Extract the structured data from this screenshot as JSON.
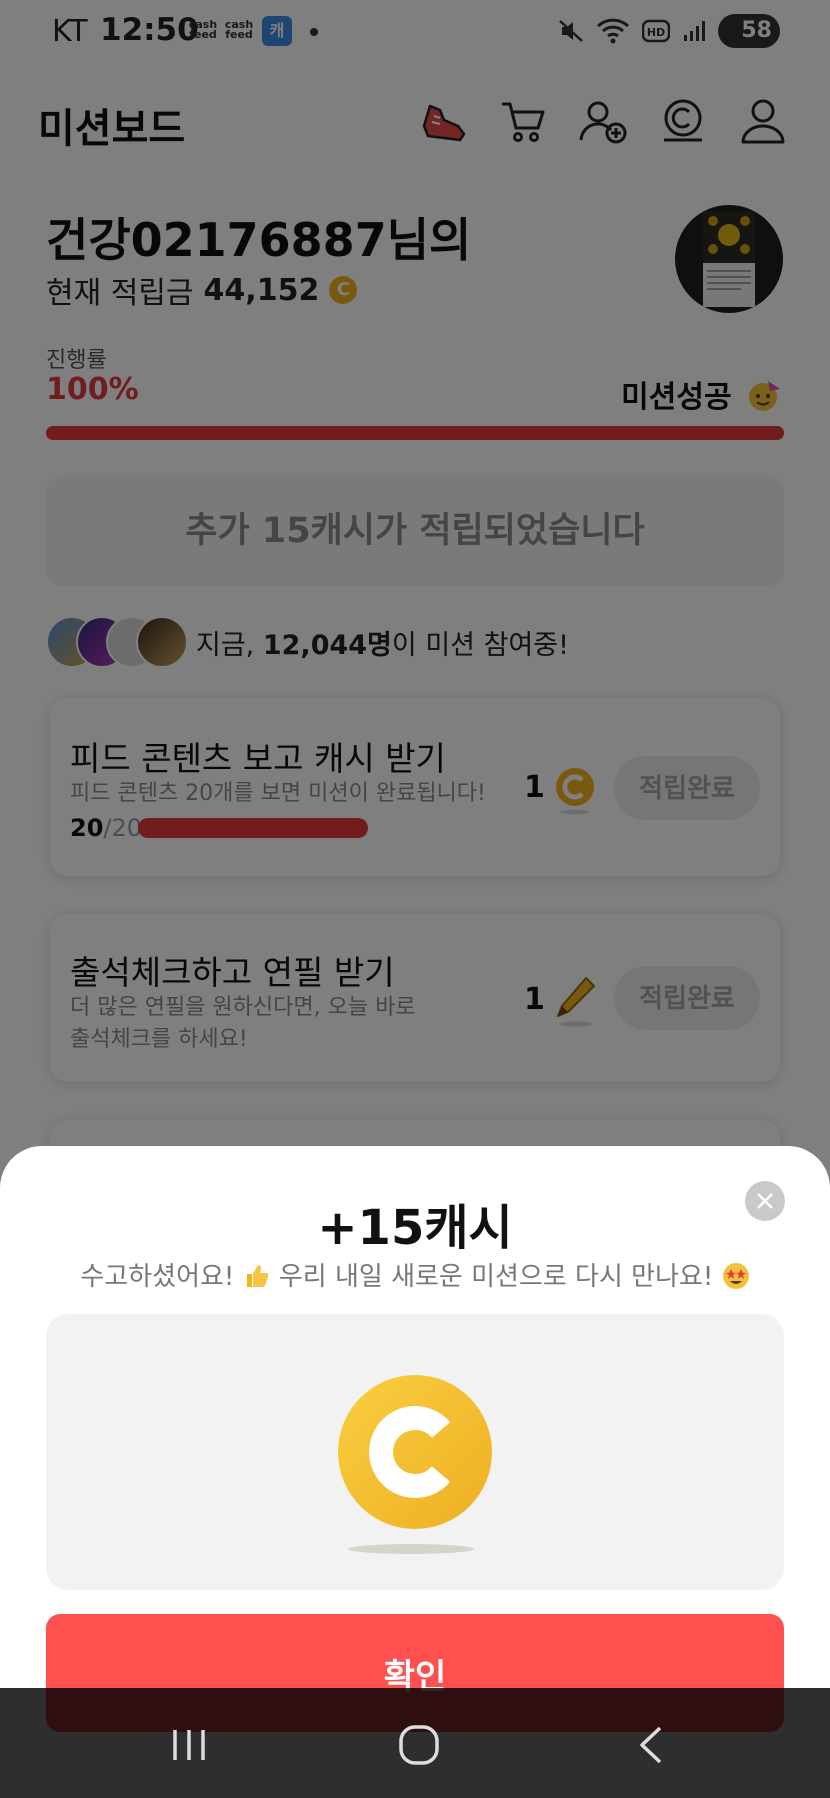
{
  "status_bar": {
    "carrier": "KT",
    "time": "12:50",
    "notif1": "cash feed",
    "notif2": "cash feed",
    "app_badge": "캐",
    "battery": "58"
  },
  "header": {
    "title": "미션보드",
    "icons": [
      "sneaker-icon",
      "cart-icon",
      "add-friend-icon",
      "cash-coin-icon",
      "profile-icon"
    ]
  },
  "profile": {
    "greeting": "건강02176887님의",
    "balance_label": "현재 적립금",
    "balance_value": "44,152",
    "coin_symbol": "C"
  },
  "progress": {
    "label": "진행률",
    "value": "100%",
    "status": "미션성공",
    "fraction": 1.0
  },
  "notice": "추가 15캐시가 적립되었습니다",
  "participants": {
    "prefix": "지금, ",
    "count": "12,044명",
    "suffix": "이 미션 참여중!"
  },
  "missions": [
    {
      "title": "피드 콘텐츠 보고 캐시 받기",
      "desc": "피드 콘텐츠 20개를 보면 미션이 완료됩니다!",
      "done": "20",
      "total": "/20",
      "fraction": 1.0,
      "reward": "1",
      "reward_icon": "coin-icon",
      "button": "적립완료"
    },
    {
      "title": "출석체크하고 연필 받기",
      "desc": "더 많은 연필을 원하신다면, 오늘 바로 출석체크를 하세요!",
      "reward": "1",
      "reward_icon": "pencil-icon",
      "button": "적립완료"
    }
  ],
  "sheet": {
    "title": "+15캐시",
    "subtitle_a": "수고하셨어요!",
    "subtitle_b": " 우리 내일 새로운 미션으로 다시 만나요!",
    "confirm": "확인"
  },
  "colors": {
    "accent_red": "#e23b3b",
    "confirm_red": "#ff5050",
    "coin_gold": "#f2b31b"
  }
}
